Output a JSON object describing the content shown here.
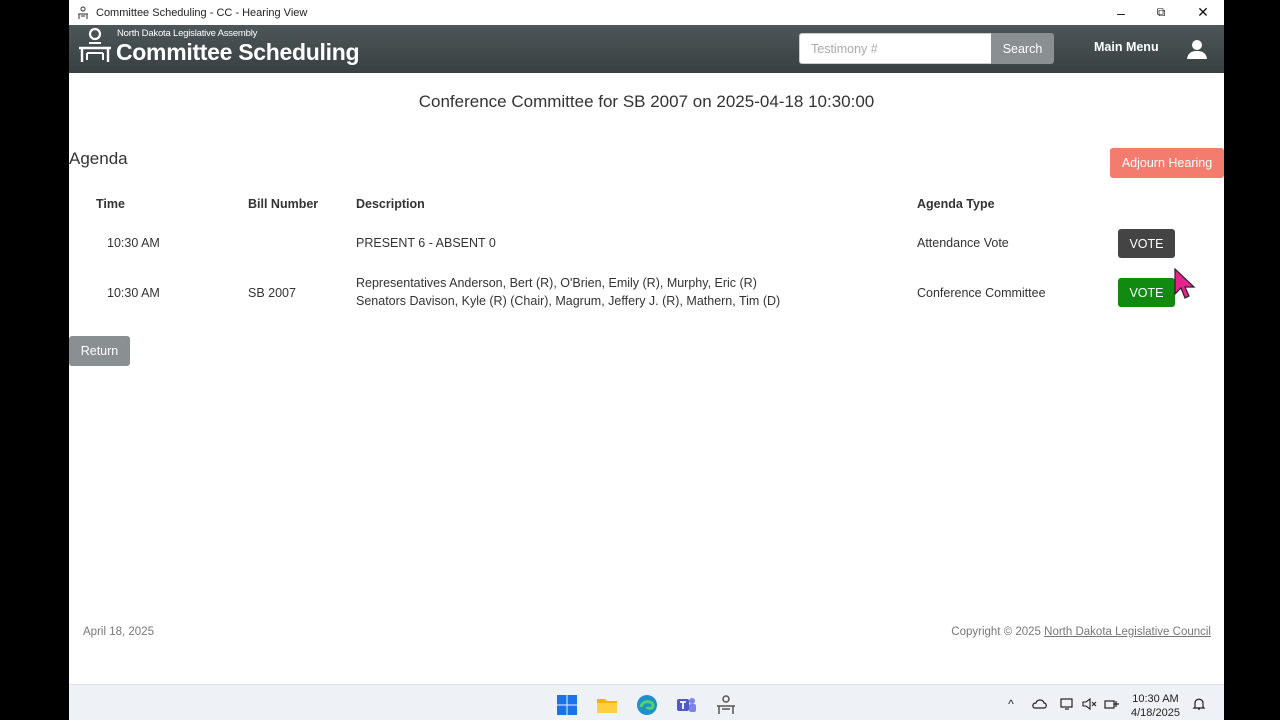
{
  "window": {
    "title": "Committee Scheduling - CC - Hearing View",
    "controls": {
      "minimize": "–",
      "restore": "⧉",
      "close": "✕"
    }
  },
  "header": {
    "org": "North Dakota Legislative Assembly",
    "app_title": "Committee Scheduling",
    "search_placeholder": "Testimony #",
    "search_value": "",
    "search_label": "Search",
    "main_menu": "Main Menu",
    "user_icon": "user-icon"
  },
  "page": {
    "title": "Conference Committee for SB 2007 on 2025-04-18 10:30:00",
    "agenda_label": "Agenda",
    "adjourn_label": "Adjourn Hearing",
    "return_label": "Return"
  },
  "table": {
    "headers": [
      "Time",
      "Bill Number",
      "Description",
      "Agenda Type"
    ],
    "rows": [
      {
        "time": "10:30 AM",
        "bill": "",
        "description": [
          "PRESENT 6 - ABSENT 0"
        ],
        "type": "Attendance Vote",
        "action": "VOTE"
      },
      {
        "time": "10:30 AM",
        "bill": "SB 2007",
        "description": [
          "Representatives Anderson, Bert (R), O'Brien, Emily (R), Murphy, Eric (R)",
          "Senators Davison, Kyle (R) (Chair), Magrum, Jeffery J. (R), Mathern, Tim (D)"
        ],
        "type": "Conference Committee",
        "action": "VOTE"
      }
    ]
  },
  "footer": {
    "date": "April 18, 2025",
    "copyright": "Copyright © 2025",
    "link": "North Dakota Legislative Council"
  },
  "taskbar": {
    "time": "10:30 AM",
    "date": "4/18/2025",
    "apps": [
      "windows-start-icon",
      "file-explorer-icon",
      "edge-browser-icon",
      "teams-icon",
      "committee-app-icon"
    ]
  },
  "colors": {
    "header": "#384042",
    "adjourn": "#f47c6e",
    "vote_attendance": "#444444",
    "vote_committee": "#118a11",
    "gray_button": "#8a8f91",
    "cursor": "#e8228f"
  }
}
